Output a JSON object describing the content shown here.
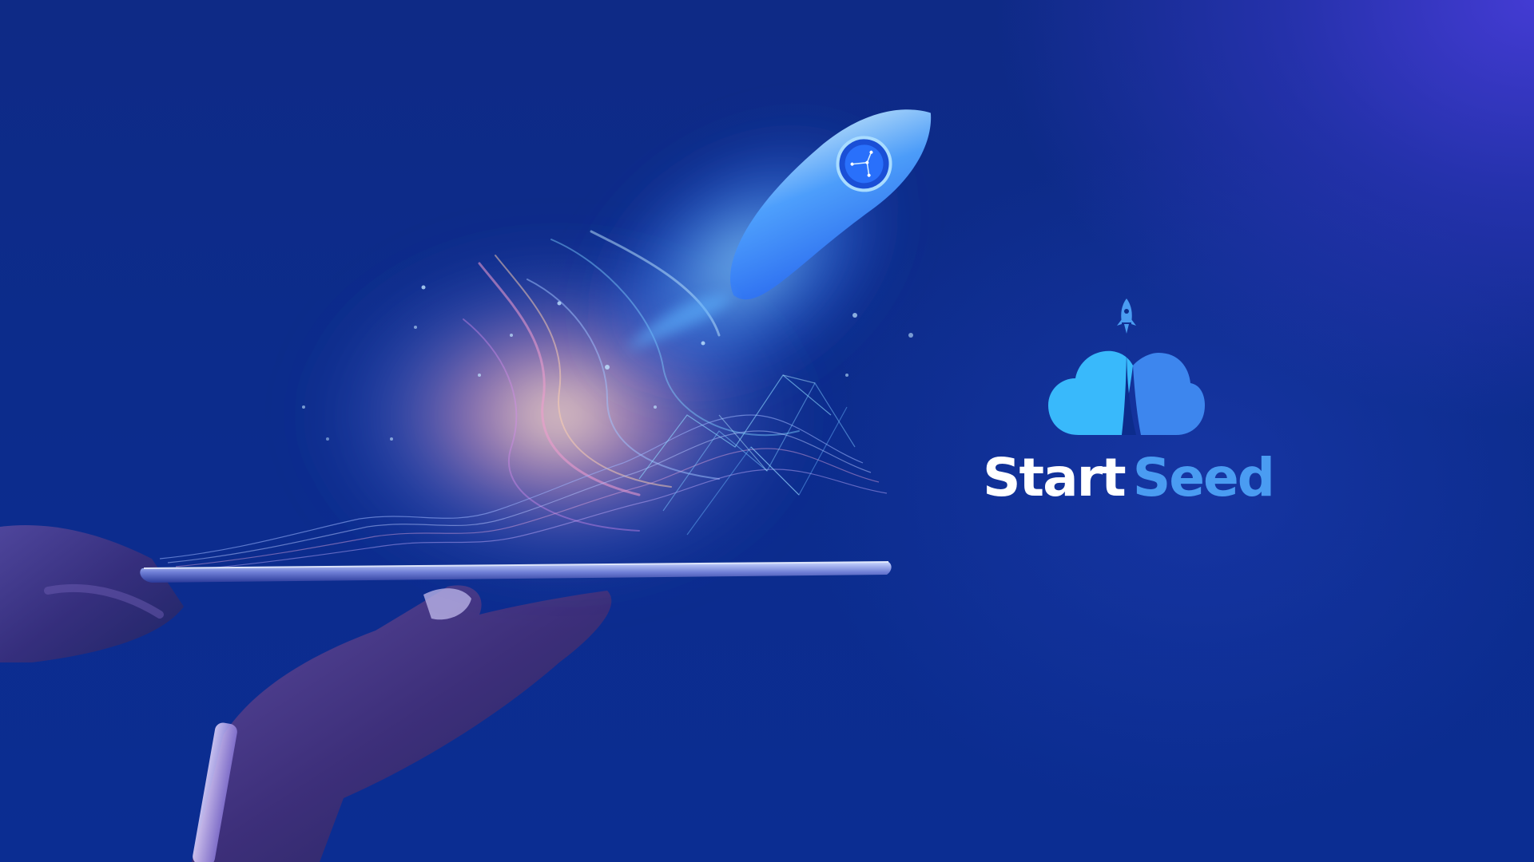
{
  "brand": {
    "name_part_1": "Start",
    "name_part_2": "Seed"
  },
  "colors": {
    "background_deep": "#0b2a86",
    "background_accent": "#463cd7",
    "brand_white": "#ffffff",
    "brand_blue": "#4a9cf2",
    "logo_cloud_light": "#39b9fb",
    "logo_cloud_dark": "#3d86ee",
    "speed_line_pink": "#e58cff",
    "speed_line_violet": "#8f7bff"
  },
  "icons": {
    "logo_mark": "rocket-cloud-logo-icon",
    "hero_rocket": "rocket-icon"
  }
}
